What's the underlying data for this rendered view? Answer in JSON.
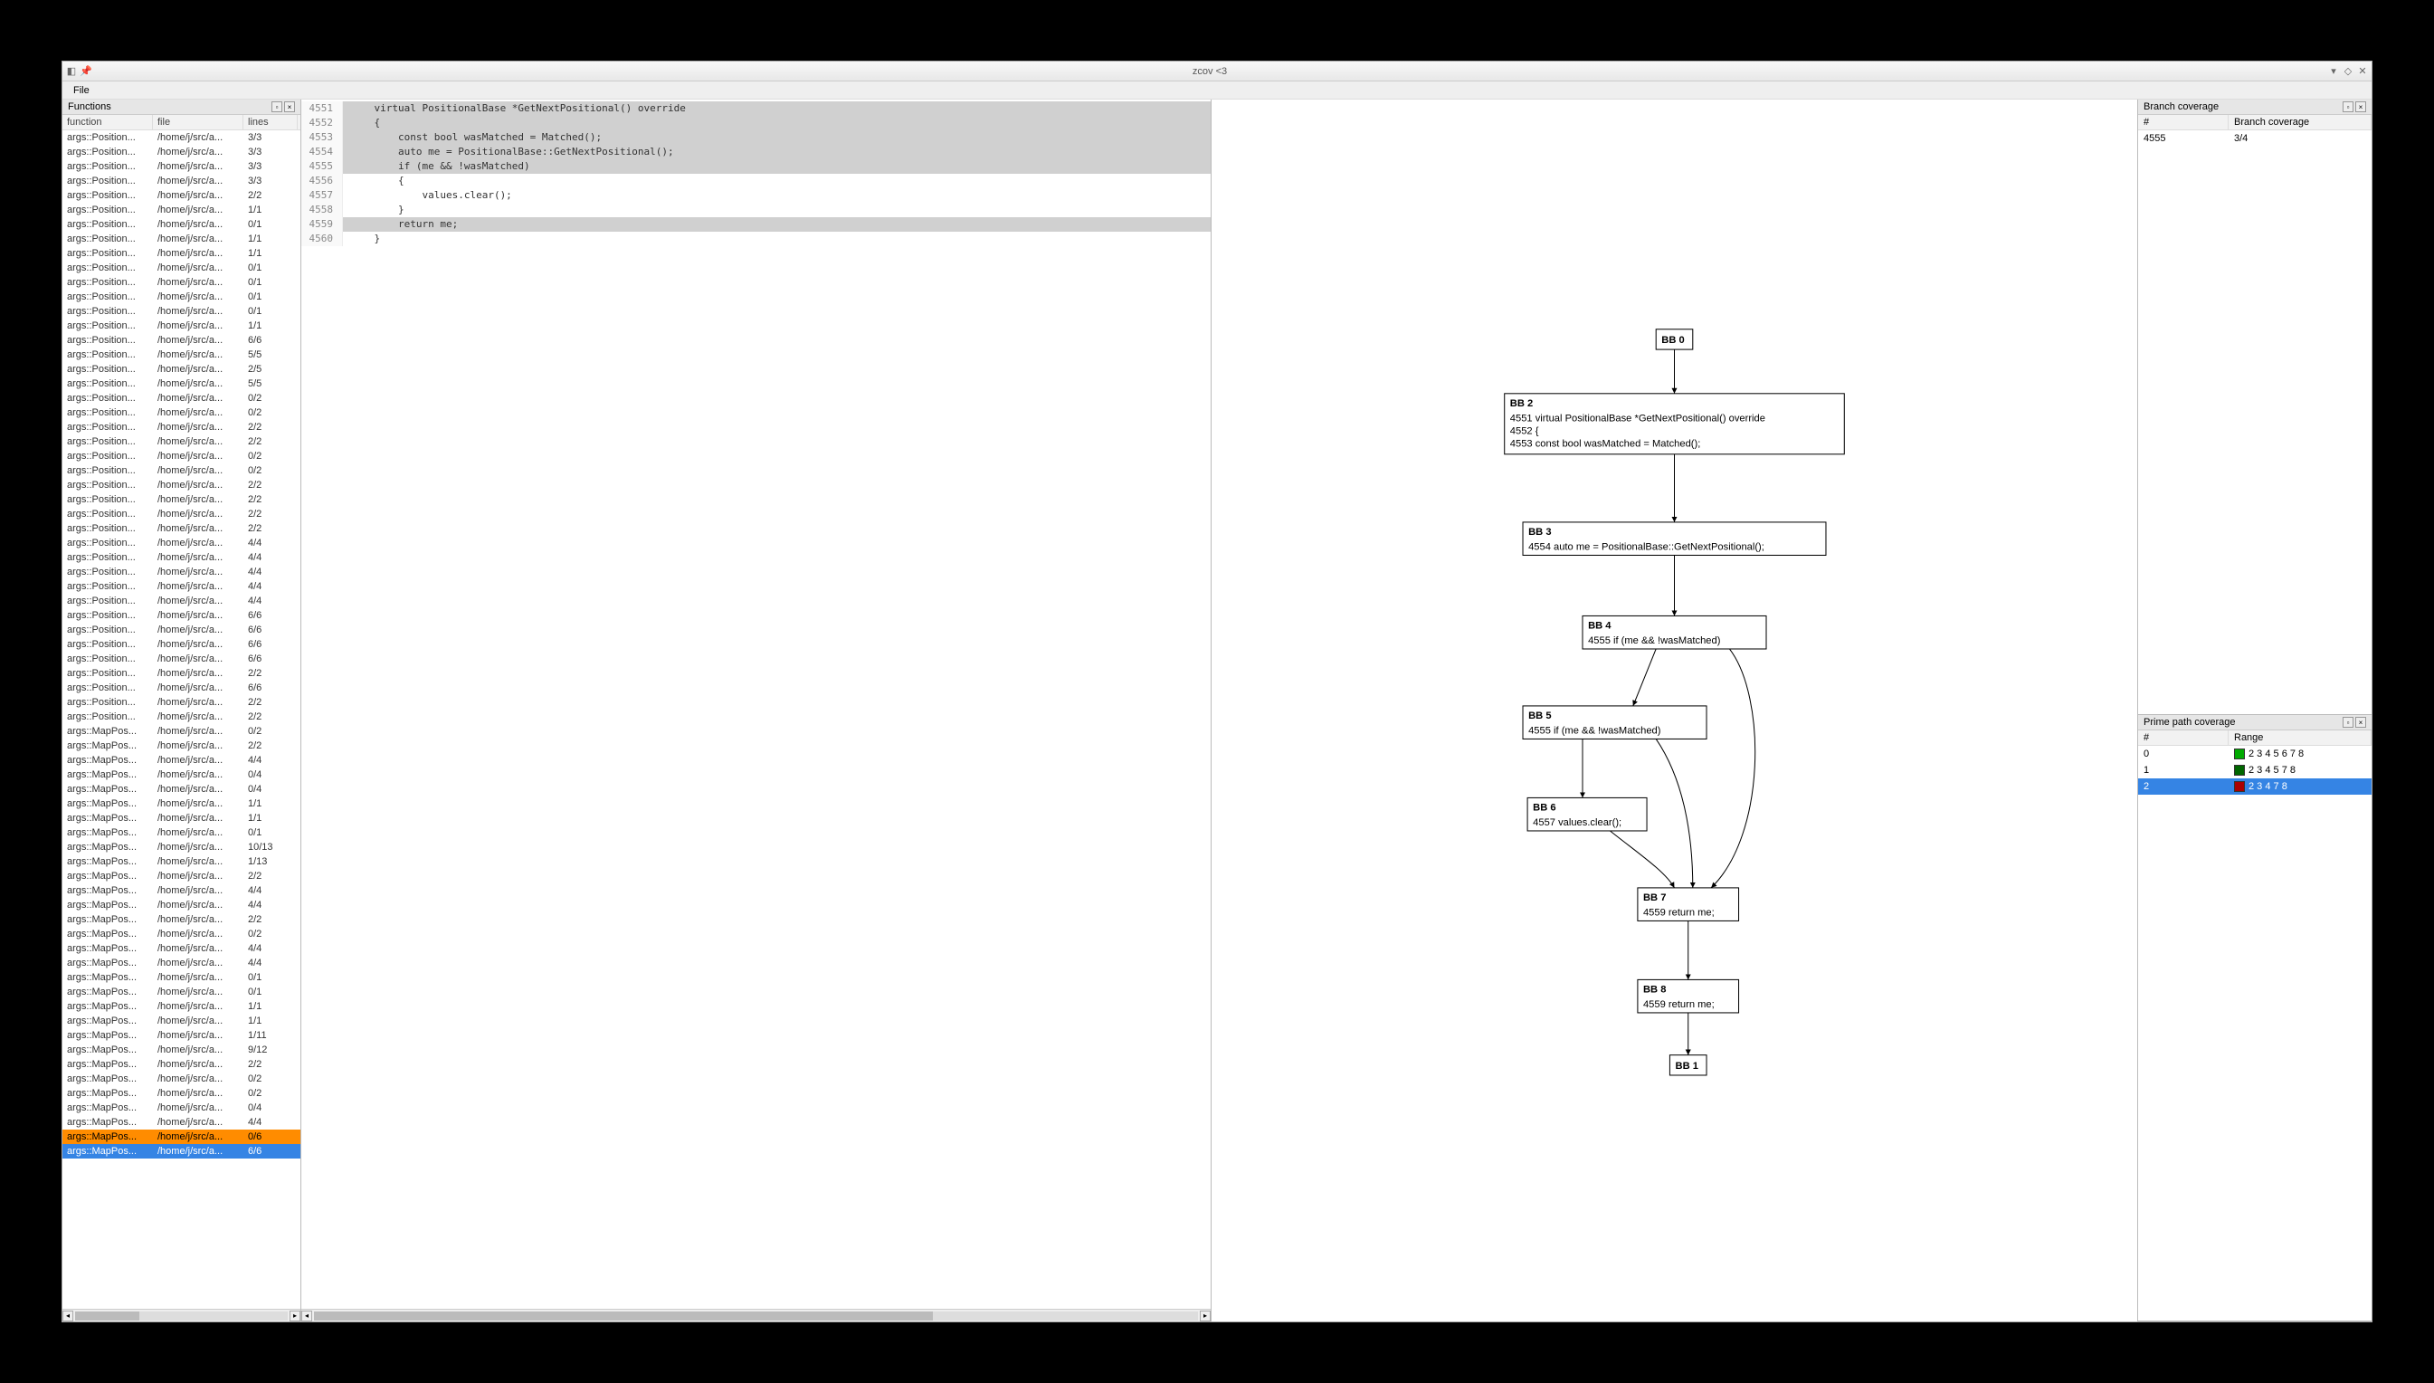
{
  "titlebar": {
    "title": "zcov <3"
  },
  "menubar": {
    "file": "File"
  },
  "functions_panel": {
    "title": "Functions",
    "cols": {
      "func": "function",
      "file": "file",
      "lines": "lines"
    },
    "rows": [
      {
        "f": "args::Position...",
        "p": "/home/j/src/a...",
        "l": "3/3"
      },
      {
        "f": "args::Position...",
        "p": "/home/j/src/a...",
        "l": "3/3"
      },
      {
        "f": "args::Position...",
        "p": "/home/j/src/a...",
        "l": "3/3"
      },
      {
        "f": "args::Position...",
        "p": "/home/j/src/a...",
        "l": "3/3"
      },
      {
        "f": "args::Position...",
        "p": "/home/j/src/a...",
        "l": "2/2"
      },
      {
        "f": "args::Position...",
        "p": "/home/j/src/a...",
        "l": "1/1"
      },
      {
        "f": "args::Position...",
        "p": "/home/j/src/a...",
        "l": "0/1"
      },
      {
        "f": "args::Position...",
        "p": "/home/j/src/a...",
        "l": "1/1"
      },
      {
        "f": "args::Position...",
        "p": "/home/j/src/a...",
        "l": "1/1"
      },
      {
        "f": "args::Position...",
        "p": "/home/j/src/a...",
        "l": "0/1"
      },
      {
        "f": "args::Position...",
        "p": "/home/j/src/a...",
        "l": "0/1"
      },
      {
        "f": "args::Position...",
        "p": "/home/j/src/a...",
        "l": "0/1"
      },
      {
        "f": "args::Position...",
        "p": "/home/j/src/a...",
        "l": "0/1"
      },
      {
        "f": "args::Position...",
        "p": "/home/j/src/a...",
        "l": "1/1"
      },
      {
        "f": "args::Position...",
        "p": "/home/j/src/a...",
        "l": "6/6"
      },
      {
        "f": "args::Position...",
        "p": "/home/j/src/a...",
        "l": "5/5"
      },
      {
        "f": "args::Position...",
        "p": "/home/j/src/a...",
        "l": "2/5"
      },
      {
        "f": "args::Position...",
        "p": "/home/j/src/a...",
        "l": "5/5"
      },
      {
        "f": "args::Position...",
        "p": "/home/j/src/a...",
        "l": "0/2"
      },
      {
        "f": "args::Position...",
        "p": "/home/j/src/a...",
        "l": "0/2"
      },
      {
        "f": "args::Position...",
        "p": "/home/j/src/a...",
        "l": "2/2"
      },
      {
        "f": "args::Position...",
        "p": "/home/j/src/a...",
        "l": "2/2"
      },
      {
        "f": "args::Position...",
        "p": "/home/j/src/a...",
        "l": "0/2"
      },
      {
        "f": "args::Position...",
        "p": "/home/j/src/a...",
        "l": "0/2"
      },
      {
        "f": "args::Position...",
        "p": "/home/j/src/a...",
        "l": "2/2"
      },
      {
        "f": "args::Position...",
        "p": "/home/j/src/a...",
        "l": "2/2"
      },
      {
        "f": "args::Position...",
        "p": "/home/j/src/a...",
        "l": "2/2"
      },
      {
        "f": "args::Position...",
        "p": "/home/j/src/a...",
        "l": "2/2"
      },
      {
        "f": "args::Position...",
        "p": "/home/j/src/a...",
        "l": "4/4"
      },
      {
        "f": "args::Position...",
        "p": "/home/j/src/a...",
        "l": "4/4"
      },
      {
        "f": "args::Position...",
        "p": "/home/j/src/a...",
        "l": "4/4"
      },
      {
        "f": "args::Position...",
        "p": "/home/j/src/a...",
        "l": "4/4"
      },
      {
        "f": "args::Position...",
        "p": "/home/j/src/a...",
        "l": "4/4"
      },
      {
        "f": "args::Position...",
        "p": "/home/j/src/a...",
        "l": "6/6"
      },
      {
        "f": "args::Position...",
        "p": "/home/j/src/a...",
        "l": "6/6"
      },
      {
        "f": "args::Position...",
        "p": "/home/j/src/a...",
        "l": "6/6"
      },
      {
        "f": "args::Position...",
        "p": "/home/j/src/a...",
        "l": "6/6"
      },
      {
        "f": "args::Position...",
        "p": "/home/j/src/a...",
        "l": "2/2"
      },
      {
        "f": "args::Position...",
        "p": "/home/j/src/a...",
        "l": "6/6"
      },
      {
        "f": "args::Position...",
        "p": "/home/j/src/a...",
        "l": "2/2"
      },
      {
        "f": "args::Position...",
        "p": "/home/j/src/a...",
        "l": "2/2"
      },
      {
        "f": "args::MapPos...",
        "p": "/home/j/src/a...",
        "l": "0/2"
      },
      {
        "f": "args::MapPos...",
        "p": "/home/j/src/a...",
        "l": "2/2"
      },
      {
        "f": "args::MapPos...",
        "p": "/home/j/src/a...",
        "l": "4/4"
      },
      {
        "f": "args::MapPos...",
        "p": "/home/j/src/a...",
        "l": "0/4"
      },
      {
        "f": "args::MapPos...",
        "p": "/home/j/src/a...",
        "l": "0/4"
      },
      {
        "f": "args::MapPos...",
        "p": "/home/j/src/a...",
        "l": "1/1"
      },
      {
        "f": "args::MapPos...",
        "p": "/home/j/src/a...",
        "l": "1/1"
      },
      {
        "f": "args::MapPos...",
        "p": "/home/j/src/a...",
        "l": "0/1"
      },
      {
        "f": "args::MapPos...",
        "p": "/home/j/src/a...",
        "l": "10/13"
      },
      {
        "f": "args::MapPos...",
        "p": "/home/j/src/a...",
        "l": "1/13"
      },
      {
        "f": "args::MapPos...",
        "p": "/home/j/src/a...",
        "l": "2/2"
      },
      {
        "f": "args::MapPos...",
        "p": "/home/j/src/a...",
        "l": "4/4"
      },
      {
        "f": "args::MapPos...",
        "p": "/home/j/src/a...",
        "l": "4/4"
      },
      {
        "f": "args::MapPos...",
        "p": "/home/j/src/a...",
        "l": "2/2"
      },
      {
        "f": "args::MapPos...",
        "p": "/home/j/src/a...",
        "l": "0/2"
      },
      {
        "f": "args::MapPos...",
        "p": "/home/j/src/a...",
        "l": "4/4"
      },
      {
        "f": "args::MapPos...",
        "p": "/home/j/src/a...",
        "l": "4/4"
      },
      {
        "f": "args::MapPos...",
        "p": "/home/j/src/a...",
        "l": "0/1"
      },
      {
        "f": "args::MapPos...",
        "p": "/home/j/src/a...",
        "l": "0/1"
      },
      {
        "f": "args::MapPos...",
        "p": "/home/j/src/a...",
        "l": "1/1"
      },
      {
        "f": "args::MapPos...",
        "p": "/home/j/src/a...",
        "l": "1/1"
      },
      {
        "f": "args::MapPos...",
        "p": "/home/j/src/a...",
        "l": "1/11"
      },
      {
        "f": "args::MapPos...",
        "p": "/home/j/src/a...",
        "l": "9/12"
      },
      {
        "f": "args::MapPos...",
        "p": "/home/j/src/a...",
        "l": "2/2"
      },
      {
        "f": "args::MapPos...",
        "p": "/home/j/src/a...",
        "l": "0/2"
      },
      {
        "f": "args::MapPos...",
        "p": "/home/j/src/a...",
        "l": "0/2"
      },
      {
        "f": "args::MapPos...",
        "p": "/home/j/src/a...",
        "l": "0/4"
      },
      {
        "f": "args::MapPos...",
        "p": "/home/j/src/a...",
        "l": "4/4"
      },
      {
        "f": "args::MapPos...",
        "p": "/home/j/src/a...",
        "l": "0/6",
        "orange": true
      },
      {
        "f": "args::MapPos...",
        "p": "/home/j/src/a...",
        "l": "6/6",
        "selected": true
      }
    ]
  },
  "code": {
    "lines": [
      {
        "n": 4551,
        "t": "    virtual PositionalBase *GetNextPositional() override",
        "hl": true
      },
      {
        "n": 4552,
        "t": "    {",
        "hl": true
      },
      {
        "n": 4553,
        "t": "        const bool wasMatched = Matched();",
        "hl": true
      },
      {
        "n": 4554,
        "t": "        auto me = PositionalBase::GetNextPositional();",
        "hl": true
      },
      {
        "n": 4555,
        "t": "        if (me && !wasMatched)",
        "hl": true
      },
      {
        "n": 4556,
        "t": "        {",
        "hl": false
      },
      {
        "n": 4557,
        "t": "            values.clear();",
        "hl": false
      },
      {
        "n": 4558,
        "t": "        }",
        "hl": false
      },
      {
        "n": 4559,
        "t": "        return me;",
        "hl": true
      },
      {
        "n": 4560,
        "t": "    }",
        "hl": false
      }
    ]
  },
  "branch_panel": {
    "title": "Branch coverage",
    "cols": {
      "c1": "#",
      "c2": "Branch coverage"
    },
    "rows": [
      {
        "c1": "4555",
        "c2": "3/4"
      }
    ]
  },
  "prime_panel": {
    "title": "Prime path coverage",
    "cols": {
      "c1": "#",
      "c2": "Range"
    },
    "rows": [
      {
        "c1": "0",
        "sq": "green",
        "c2": "2 3 4 5 6 7 8"
      },
      {
        "c1": "1",
        "sq": "dkgreen",
        "c2": "2 3 4 5 7 8"
      },
      {
        "c1": "2",
        "sq": "red",
        "c2": "2 3 4 7 8",
        "selected": true
      }
    ]
  },
  "diagram": {
    "nodes": {
      "bb0": {
        "title": "BB 0"
      },
      "bb2": {
        "title": "BB 2",
        "lines": [
          "4551 virtual PositionalBase *GetNextPositional() override",
          "4552 {",
          "4553 const bool wasMatched = Matched();"
        ]
      },
      "bb3": {
        "title": "BB 3",
        "lines": [
          "4554 auto me = PositionalBase::GetNextPositional();"
        ]
      },
      "bb4": {
        "title": "BB 4",
        "lines": [
          "4555 if (me && !wasMatched)"
        ]
      },
      "bb5": {
        "title": "BB 5",
        "lines": [
          "4555 if (me && !wasMatched)"
        ]
      },
      "bb6": {
        "title": "BB 6",
        "lines": [
          "4557 values.clear();"
        ]
      },
      "bb7": {
        "title": "BB 7",
        "lines": [
          "4559 return me;"
        ]
      },
      "bb8": {
        "title": "BB 8",
        "lines": [
          "4559 return me;"
        ]
      },
      "bb1": {
        "title": "BB 1"
      }
    }
  }
}
